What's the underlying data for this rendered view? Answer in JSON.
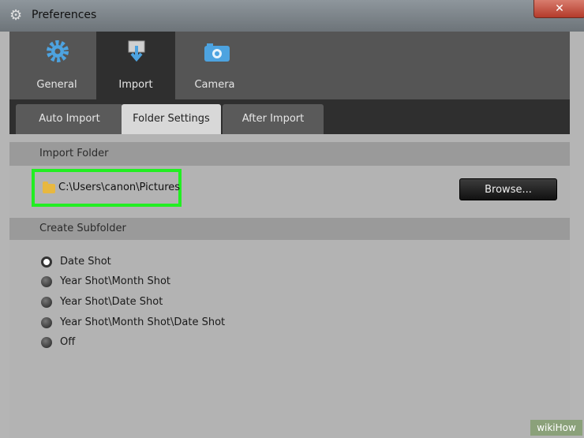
{
  "window": {
    "title": "Preferences",
    "close_label": "✕"
  },
  "main_tabs": [
    {
      "label": "General"
    },
    {
      "label": "Import"
    },
    {
      "label": "Camera"
    }
  ],
  "sub_tabs": [
    {
      "label": "Auto Import"
    },
    {
      "label": "Folder Settings"
    },
    {
      "label": "After Import"
    }
  ],
  "import_folder": {
    "heading": "Import Folder",
    "path": "C:\\Users\\canon\\Pictures",
    "browse_label": "Browse..."
  },
  "create_subfolder": {
    "heading": "Create Subfolder",
    "options": [
      {
        "label": "Date Shot",
        "selected": true
      },
      {
        "label": "Year Shot\\Month Shot",
        "selected": false
      },
      {
        "label": "Year Shot\\Date Shot",
        "selected": false
      },
      {
        "label": "Year Shot\\Month Shot\\Date Shot",
        "selected": false
      },
      {
        "label": "Off",
        "selected": false
      }
    ]
  },
  "watermark": "wikiHow",
  "colors": {
    "highlight": "#22ee22",
    "active_tab": "#2f2f2f"
  }
}
